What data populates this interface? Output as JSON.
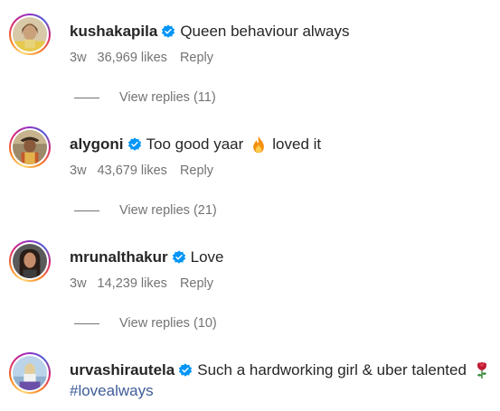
{
  "comments": [
    {
      "username": "kushakapila",
      "text": "Queen behaviour always",
      "time": "3w",
      "likes": "36,969 likes",
      "reply": "Reply",
      "view_replies": "View replies (11)"
    },
    {
      "username": "alygoni",
      "text_before": "Too good yaar",
      "emoji": "fire-emoji",
      "text_after": "loved it",
      "time": "3w",
      "likes": "43,679 likes",
      "reply": "Reply",
      "view_replies": "View replies (21)"
    },
    {
      "username": "mrunalthakur",
      "text": "Love",
      "time": "3w",
      "likes": "14,239 likes",
      "reply": "Reply",
      "view_replies": "View replies (10)"
    },
    {
      "username": "urvashirautela",
      "text": "Such a hardworking girl & uber talented",
      "emoji": "rose-emoji",
      "hashtag": "#lovealways"
    }
  ],
  "colors": {
    "verified": "#0095f6",
    "meta": "#737373",
    "text": "#262626",
    "hashtag": "#3f5d9a"
  }
}
